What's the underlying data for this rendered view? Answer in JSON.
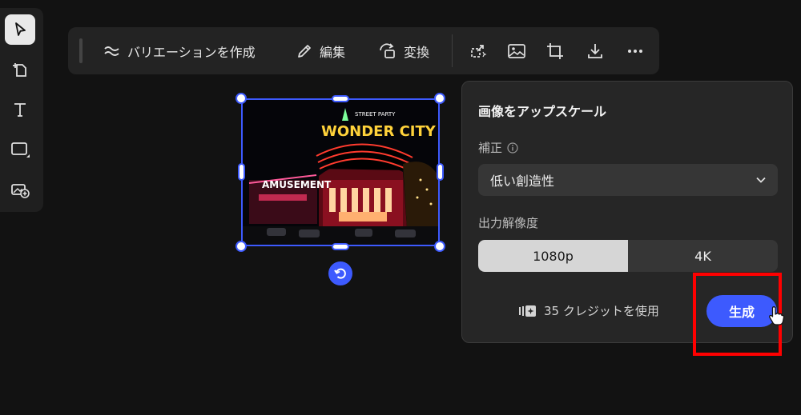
{
  "toolbar": {
    "variation_label": "バリエーションを作成",
    "edit_label": "編集",
    "transform_label": "変換"
  },
  "panel": {
    "title": "画像をアップスケール",
    "correction_label": "補正",
    "correction_value": "低い創造性",
    "resolution_label": "出力解像度",
    "resolution_options": [
      "1080p",
      "4K"
    ],
    "resolution_selected": "1080p",
    "credits_text": "35 クレジットを使用",
    "generate_label": "生成"
  },
  "image": {
    "sign_title": "WONDER CITY",
    "sign_top": "STREET PARTY",
    "sign_left": "AMUSEMENT"
  },
  "colors": {
    "accent": "#3d5afe",
    "highlight": "#ff0000",
    "panel_bg": "#262626"
  },
  "icons": {
    "rail": [
      "cursor-arrow-icon",
      "add-page-icon",
      "text-icon",
      "rectangle-shape-icon",
      "image-add-icon"
    ],
    "toolbar": [
      "wave-icon",
      "pencil-icon",
      "transform-icon",
      "upscale-icon",
      "image-icon",
      "crop-icon",
      "download-icon",
      "more-icon"
    ]
  }
}
